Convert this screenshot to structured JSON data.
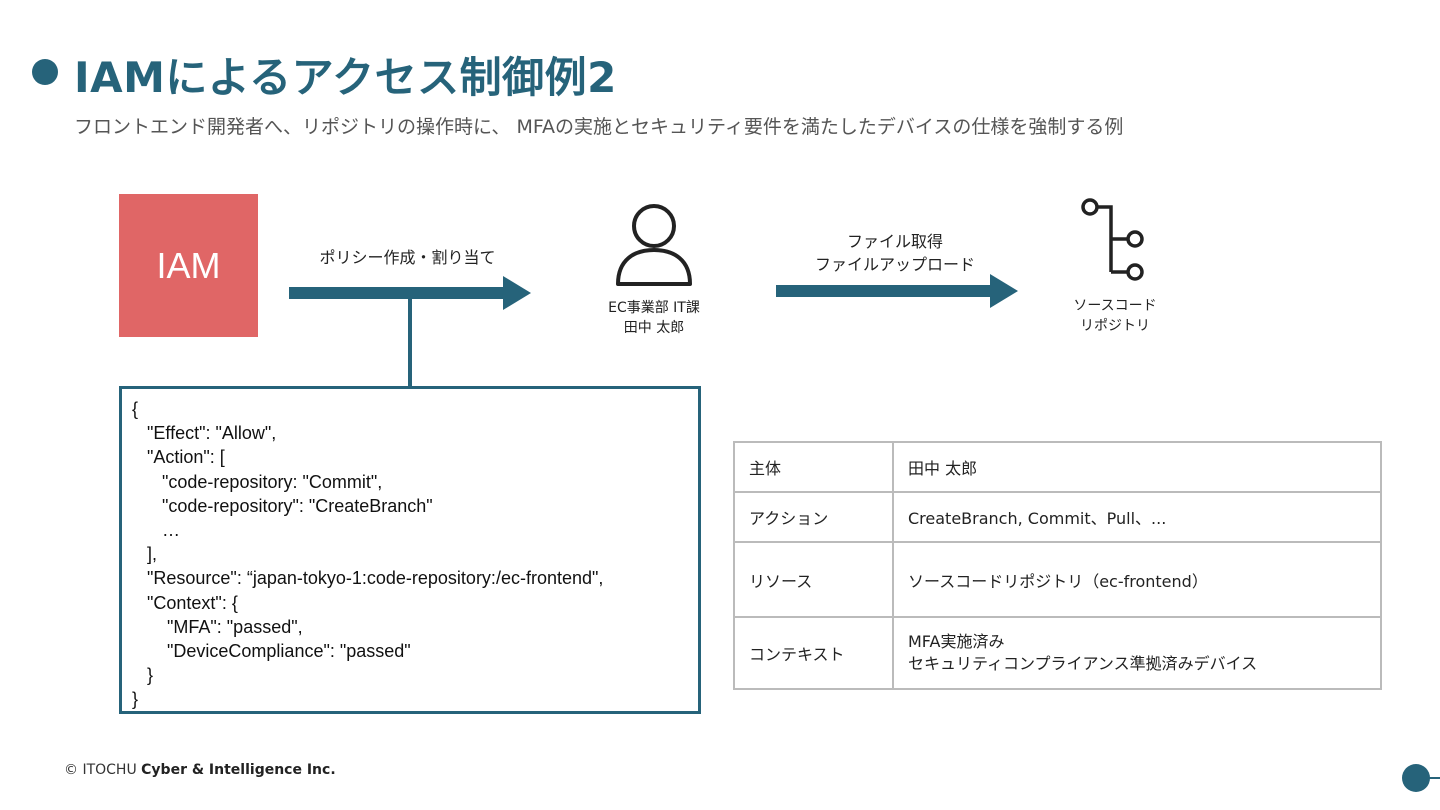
{
  "header": {
    "title": "IAMによるアクセス制御例2",
    "subtitle": "フロントエンド開発者へ、リポジトリの操作時に、 MFAの実施とセキュリティ要件を満たしたデバイスの仕様を強制する例"
  },
  "iam": {
    "label": "IAM"
  },
  "arrow1": {
    "label": "ポリシー作成・割り当て"
  },
  "user": {
    "line1": "EC事業部 IT課",
    "line2": "田中 太郎",
    "icon": "user-icon"
  },
  "arrow2": {
    "line1": "ファイル取得",
    "line2": "ファイルアップロード"
  },
  "repo": {
    "line1": "ソースコード",
    "line2": "リポジトリ",
    "icon": "repository-branch-icon"
  },
  "policy": {
    "lines": [
      "{",
      "   \"Effect\": \"Allow\",",
      "   \"Action\": [",
      "      \"code-repository: \"Commit\",",
      "      \"code-repository\": \"CreateBranch\"",
      "      …",
      "   ],",
      "   \"Resource\": “japan-tokyo-1:code-repository:/ec-frontend\",",
      "   \"Context\": {",
      "       \"MFA\": \"passed\",",
      "       \"DeviceCompliance\": \"passed\"",
      "   }",
      "}"
    ]
  },
  "table": {
    "rows": [
      {
        "key": "主体",
        "value": "田中 太郎"
      },
      {
        "key": "アクション",
        "value": "CreateBranch, Commit、Pull、..."
      },
      {
        "key": "リソース",
        "value": "ソースコードリポジトリ（ec-frontend）"
      },
      {
        "key": "コンテキスト",
        "value": "MFA実施済み",
        "value2": "セキュリティコンプライアンス準拠済みデバイス"
      }
    ]
  },
  "footer": {
    "copyright": "© ITOCHU ",
    "company": "Cyber & Intelligence Inc."
  },
  "colors": {
    "accent": "#26637a",
    "iam": "#e06666",
    "table_border": "#bbbbbb"
  }
}
